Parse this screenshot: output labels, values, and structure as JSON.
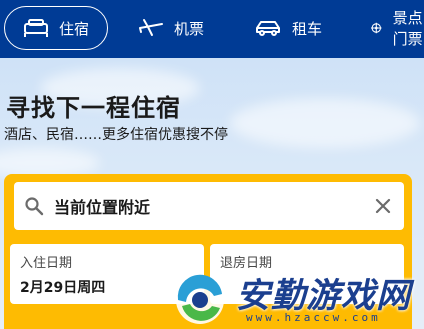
{
  "nav": {
    "items": [
      {
        "label": "住宿",
        "icon": "bed-icon"
      },
      {
        "label": "机票",
        "icon": "plane-icon"
      },
      {
        "label": "租车",
        "icon": "car-icon"
      },
      {
        "label": "景点门票",
        "icon": "attraction-icon"
      }
    ]
  },
  "hero": {
    "title": "寻找下一程住宿",
    "subtitle": "酒店、民宿……更多住宿优惠搜不停"
  },
  "search": {
    "location": "当前位置附近",
    "checkin_label": "入住日期",
    "checkin_value": "2月29日周四",
    "checkout_label": "退房日期"
  },
  "watermark": {
    "text": "安勤游戏网",
    "url": "www.hzaccw.com"
  },
  "colors": {
    "brand_blue": "#003b95",
    "search_yellow": "#febb02"
  }
}
